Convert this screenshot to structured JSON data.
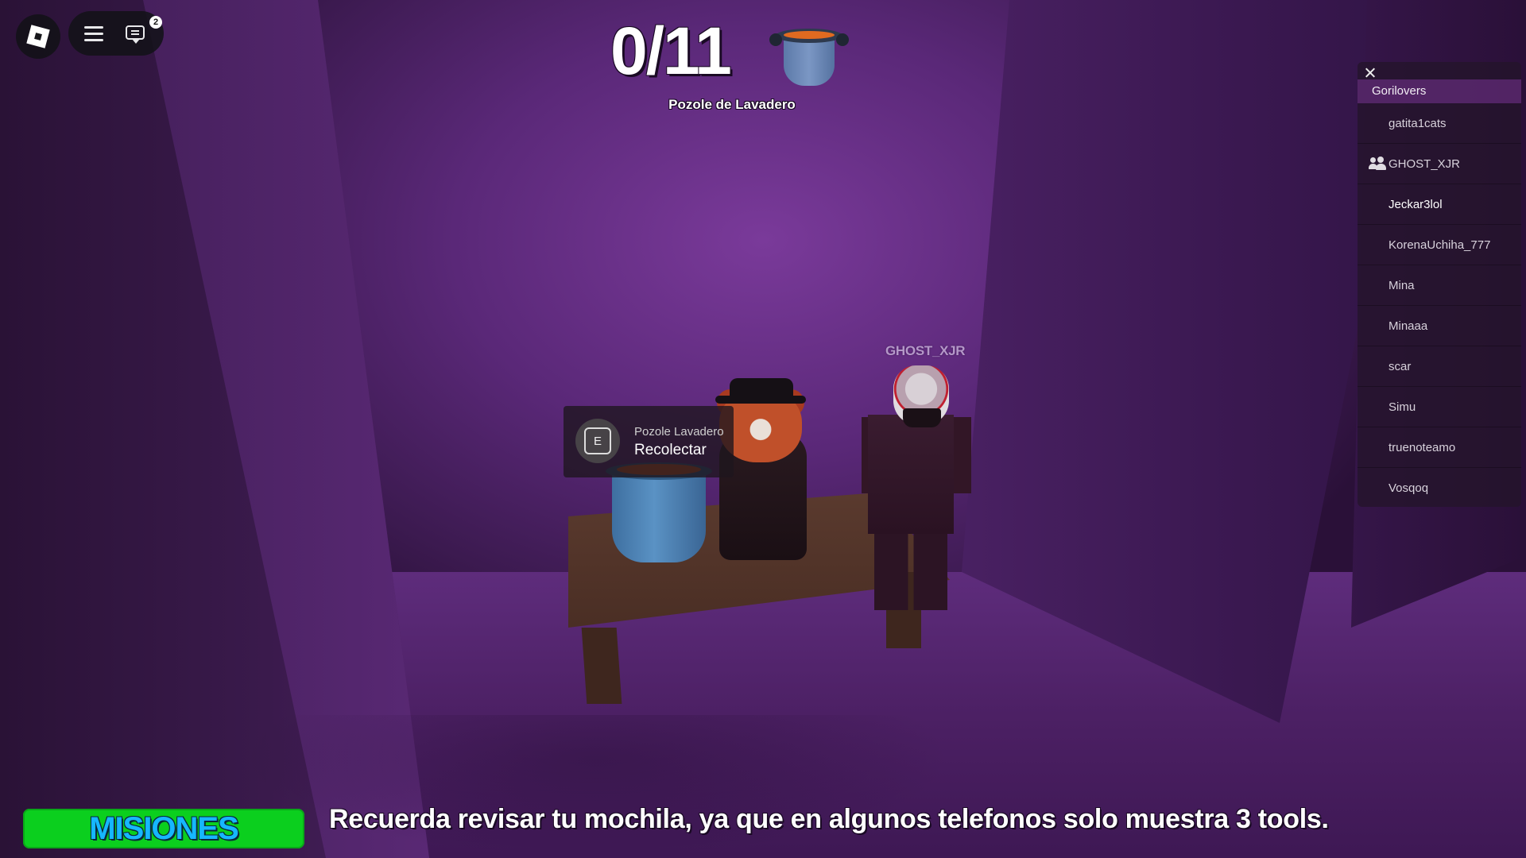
{
  "topbar": {
    "roblox_menu_icon": "roblox-logo",
    "hamburger_icon": "hamburger-menu",
    "chat_icon": "chat-bubble",
    "chat_badge": "2"
  },
  "collectible": {
    "counter": "0/11",
    "label": "Pozole de Lavadero",
    "icon": "pot-icon"
  },
  "scene": {
    "player_nametag": "GHOST_XJR"
  },
  "prompt": {
    "key": "E",
    "object_text": "Pozole Lavadero",
    "action_text": "Recolectar"
  },
  "playerlist": {
    "close_icon": "close-x",
    "team_name": "Gorilovers",
    "players": [
      {
        "name": "gatita1cats"
      },
      {
        "name": "GHOST_XJR",
        "friend_icon": true
      },
      {
        "name": "Jeckar3lol",
        "is_local": true
      },
      {
        "name": "KorenaUchiha_777"
      },
      {
        "name": "Mina"
      },
      {
        "name": "Minaaa"
      },
      {
        "name": "scar"
      },
      {
        "name": "Simu"
      },
      {
        "name": "truenoteamo"
      },
      {
        "name": "Vosqoq"
      }
    ]
  },
  "bottom": {
    "missions_button": "MISIONES",
    "tip": "Recuerda revisar tu mochila, ya que en algunos telefonos solo muestra 3 tools."
  },
  "colors": {
    "missions_bg": "#0bcf1e",
    "missions_text": "#16b7ff",
    "scene_purple": "#5a2878"
  }
}
